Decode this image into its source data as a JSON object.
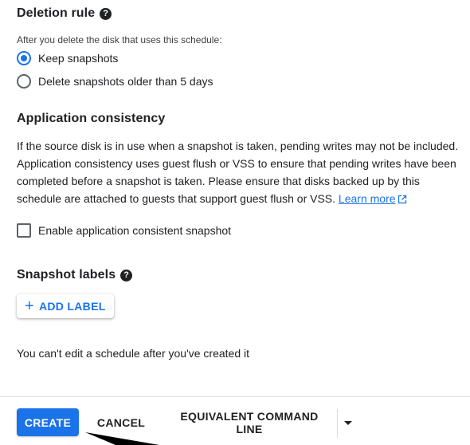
{
  "deletion_rule": {
    "title": "Deletion rule",
    "hint": "After you delete the disk that uses this schedule:",
    "options": [
      {
        "label": "Keep snapshots",
        "checked": true
      },
      {
        "label": "Delete snapshots older than 5 days",
        "checked": false
      }
    ]
  },
  "app_consistency": {
    "title": "Application consistency",
    "description": "If the source disk is in use when a snapshot is taken, pending writes may not be included. Application consistency uses guest flush or VSS to ensure that pending writes have been completed before a snapshot is taken. Please ensure that disks backed up by this schedule are attached to guests that support guest flush or VSS.",
    "learn_more": "Learn more",
    "checkbox_label": "Enable application consistent snapshot",
    "checkbox_checked": false
  },
  "snapshot_labels": {
    "title": "Snapshot labels",
    "add_label": "ADD LABEL"
  },
  "note": "You can't edit a schedule after you've created it",
  "footer": {
    "create": "CREATE",
    "cancel": "CANCEL",
    "equivalent": "EQUIVALENT COMMAND LINE"
  },
  "colors": {
    "accent": "#1a73e8",
    "text": "#202124"
  },
  "icons": [
    "help-icon",
    "external-link-icon",
    "plus-icon",
    "dropdown-caret-icon",
    "mouse-cursor-icon"
  ]
}
